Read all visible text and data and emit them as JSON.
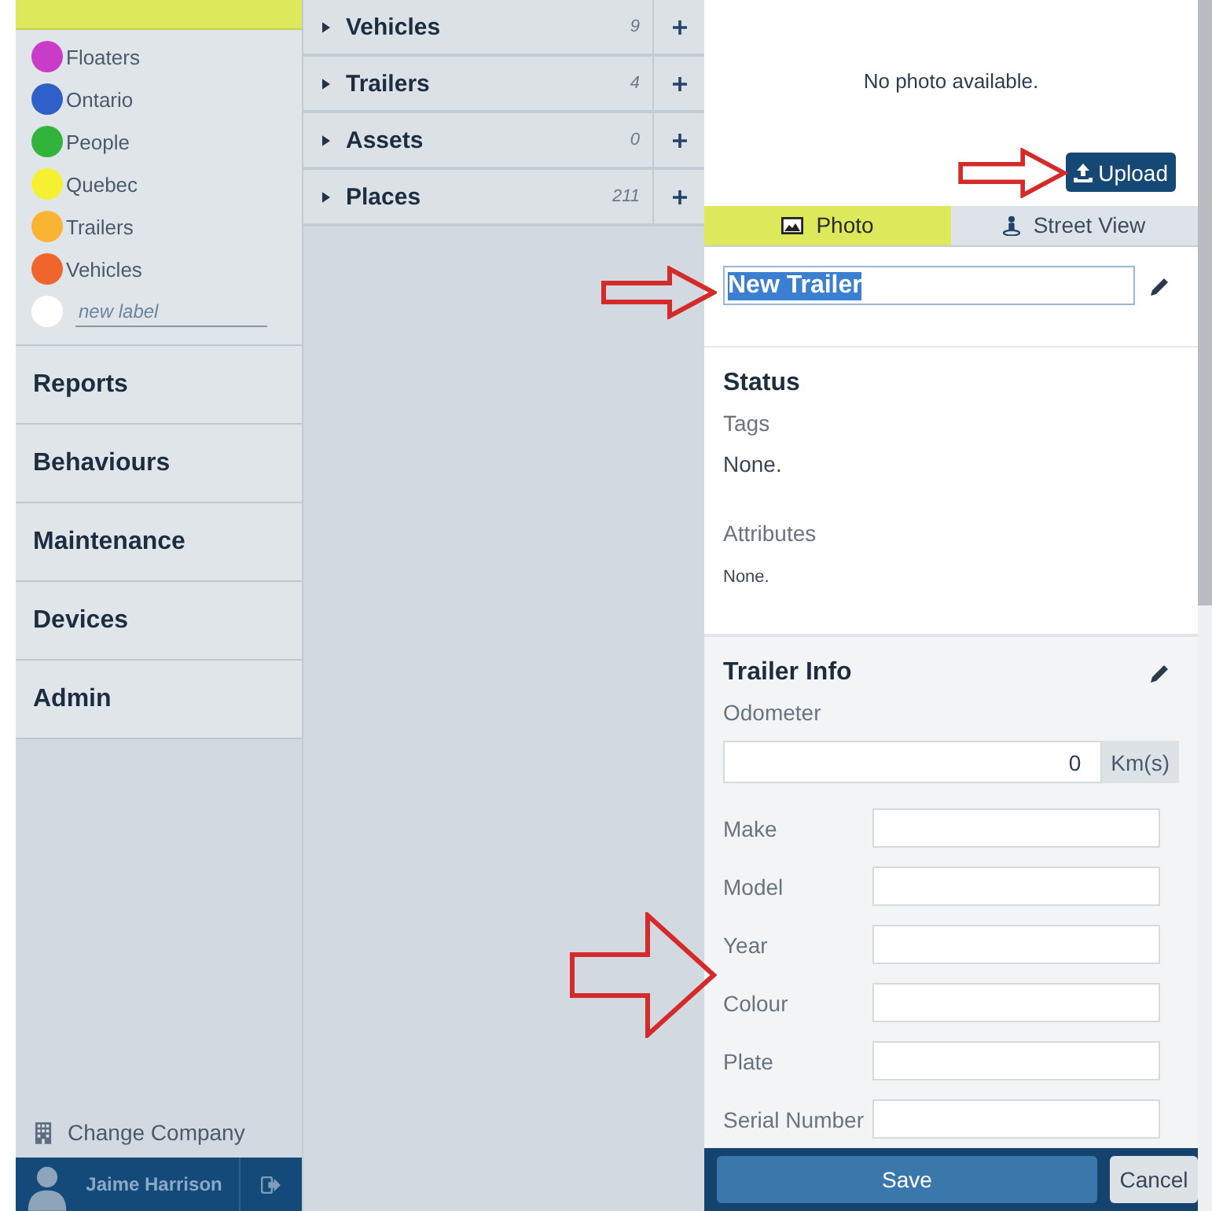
{
  "sidebar": {
    "labels": [
      {
        "name": "Floaters",
        "color": "#c83cc8"
      },
      {
        "name": "Ontario",
        "color": "#2f5fc8"
      },
      {
        "name": "People",
        "color": "#32b43c"
      },
      {
        "name": "Quebec",
        "color": "#f5f032"
      },
      {
        "name": "Trailers",
        "color": "#f8b432"
      },
      {
        "name": "Vehicles",
        "color": "#f0642d"
      }
    ],
    "new_label_placeholder": "new label",
    "nav_items": [
      "Reports",
      "Behaviours",
      "Maintenance",
      "Devices",
      "Admin"
    ],
    "change_company": "Change Company",
    "user": "Jaime Harrison"
  },
  "groups": [
    {
      "name": "Vehicles",
      "count": "9",
      "expanded": false
    },
    {
      "name": "Trailers",
      "count": "4",
      "expanded": false
    },
    {
      "name": "Assets",
      "count": "0",
      "expanded": false
    },
    {
      "name": "Places",
      "count": "211",
      "expanded": false
    }
  ],
  "detail": {
    "photo_message": "No photo available.",
    "upload": "Upload",
    "tabs": [
      {
        "label": "Photo",
        "selected": true
      },
      {
        "label": "Street View",
        "selected": false
      }
    ],
    "name": "New Trailer",
    "status": {
      "title": "Status",
      "tags_label": "Tags",
      "tags_value": "None.",
      "attributes_label": "Attributes",
      "attributes_value": "None."
    },
    "info": {
      "title": "Trailer Info",
      "odometer_label": "Odometer",
      "odometer_value": "0",
      "odometer_unit": "Km(s)",
      "fields": [
        {
          "label": "Make"
        },
        {
          "label": "Model"
        },
        {
          "label": "Year"
        },
        {
          "label": "Colour"
        },
        {
          "label": "Plate"
        },
        {
          "label": "Serial Number"
        }
      ]
    },
    "save": "Save",
    "cancel": "Cancel"
  }
}
